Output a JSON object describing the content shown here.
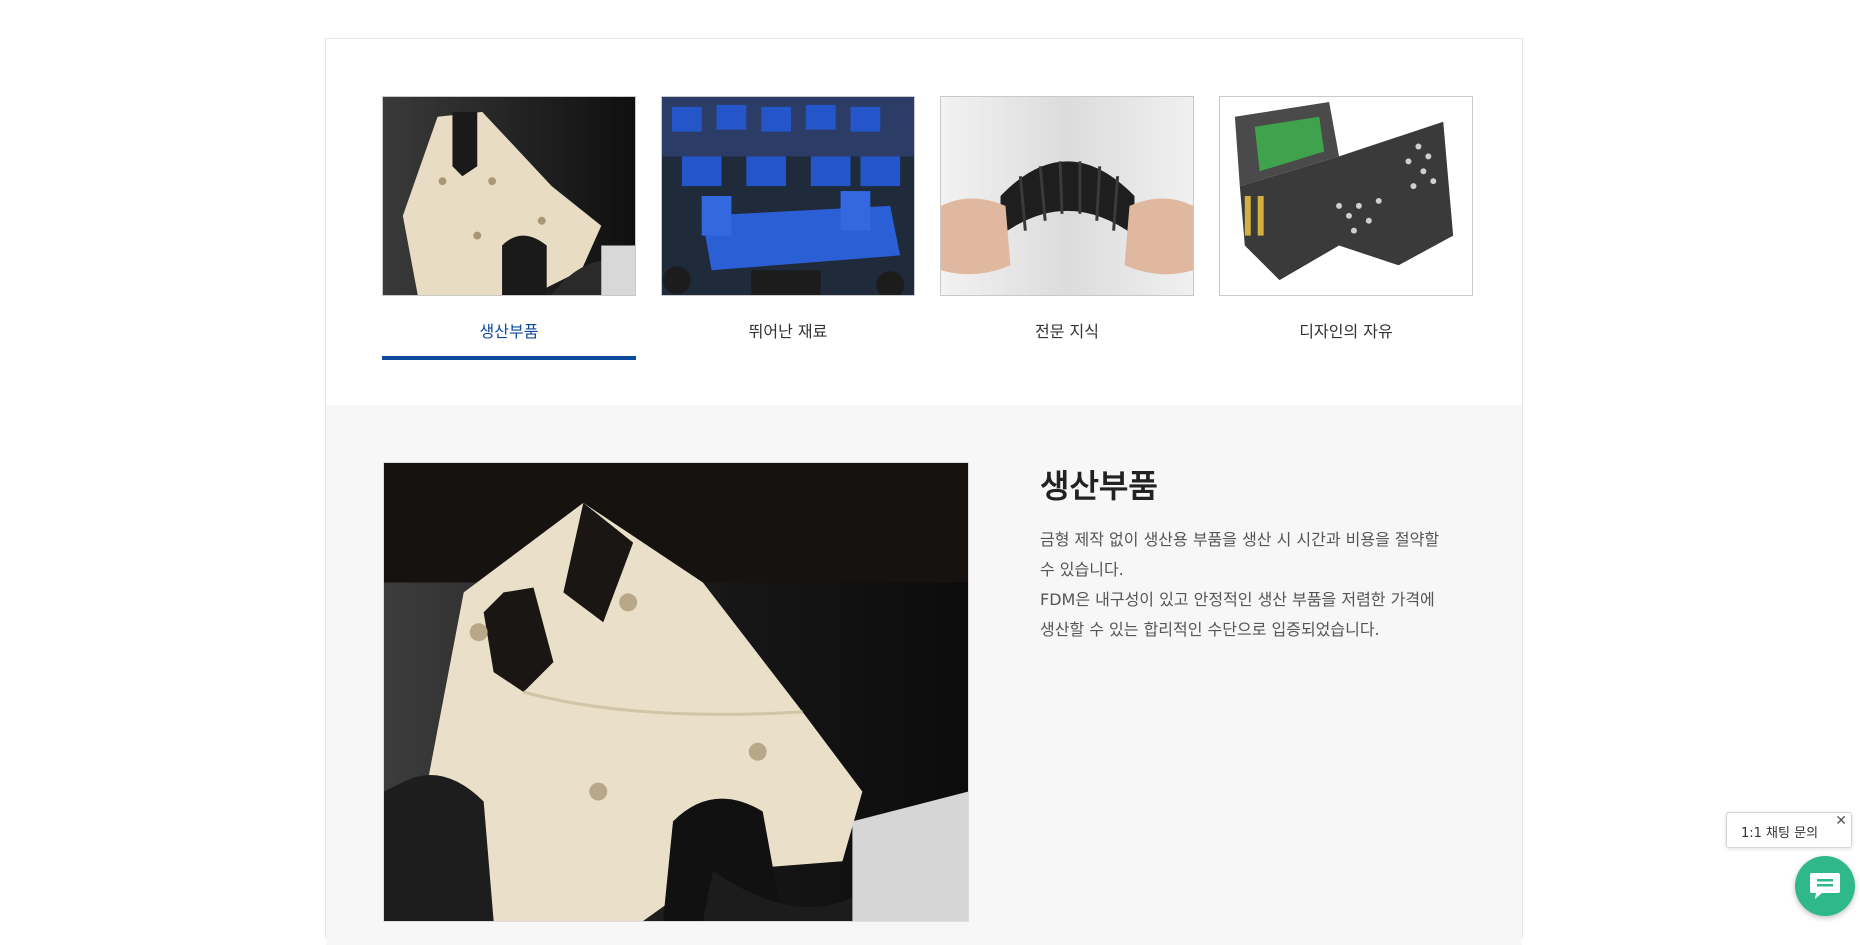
{
  "tabs": [
    {
      "label": "생산부품",
      "active": true,
      "image_icon": "production-part-thumbnail"
    },
    {
      "label": "뛰어난 재료",
      "active": false,
      "image_icon": "materials-thumbnail"
    },
    {
      "label": "전문 지식",
      "active": false,
      "image_icon": "expertise-thumbnail"
    },
    {
      "label": "디자인의 자유",
      "active": false,
      "image_icon": "design-freedom-thumbnail"
    }
  ],
  "detail": {
    "title": "생산부품",
    "paragraph_1": "금형 제작 없이 생산용 부품을 생산 시 시간과 비용을 절약할 수 있습니다.",
    "paragraph_2": "FDM은 내구성이 있고 안정적인 생산 부품을 저렴한 가격에 생산할 수 있는 합리적인 수단으로 입증되었습니다."
  },
  "chat": {
    "label": "1:1 채팅 문의",
    "close": "✕",
    "fab_icon": "chat-bubble-icon"
  },
  "colors": {
    "accent": "#0d4a9e",
    "chat_green": "#2fb98a",
    "panel_bg": "#f7f7f7"
  }
}
